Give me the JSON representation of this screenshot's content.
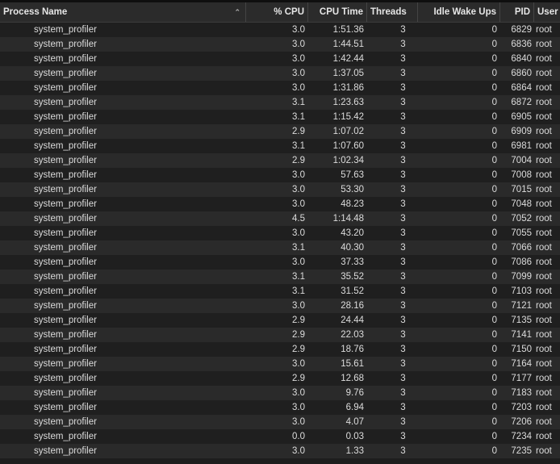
{
  "columns": [
    {
      "label": "Process Name",
      "sorted": "ascending"
    },
    {
      "label": "% CPU"
    },
    {
      "label": "CPU Time"
    },
    {
      "label": "Threads"
    },
    {
      "label": "Idle Wake Ups"
    },
    {
      "label": "PID"
    },
    {
      "label": "User"
    }
  ],
  "sort_icon": "chevron-up-icon",
  "rows": [
    [
      "system_profiler",
      "3.0",
      "1:51.36",
      "3",
      "0",
      "6829",
      "root"
    ],
    [
      "system_profiler",
      "3.0",
      "1:44.51",
      "3",
      "0",
      "6836",
      "root"
    ],
    [
      "system_profiler",
      "3.0",
      "1:42.44",
      "3",
      "0",
      "6840",
      "root"
    ],
    [
      "system_profiler",
      "3.0",
      "1:37.05",
      "3",
      "0",
      "6860",
      "root"
    ],
    [
      "system_profiler",
      "3.0",
      "1:31.86",
      "3",
      "0",
      "6864",
      "root"
    ],
    [
      "system_profiler",
      "3.1",
      "1:23.63",
      "3",
      "0",
      "6872",
      "root"
    ],
    [
      "system_profiler",
      "3.1",
      "1:15.42",
      "3",
      "0",
      "6905",
      "root"
    ],
    [
      "system_profiler",
      "2.9",
      "1:07.02",
      "3",
      "0",
      "6909",
      "root"
    ],
    [
      "system_profiler",
      "3.1",
      "1:07.60",
      "3",
      "0",
      "6981",
      "root"
    ],
    [
      "system_profiler",
      "2.9",
      "1:02.34",
      "3",
      "0",
      "7004",
      "root"
    ],
    [
      "system_profiler",
      "3.0",
      "57.63",
      "3",
      "0",
      "7008",
      "root"
    ],
    [
      "system_profiler",
      "3.0",
      "53.30",
      "3",
      "0",
      "7015",
      "root"
    ],
    [
      "system_profiler",
      "3.0",
      "48.23",
      "3",
      "0",
      "7048",
      "root"
    ],
    [
      "system_profiler",
      "4.5",
      "1:14.48",
      "3",
      "0",
      "7052",
      "root"
    ],
    [
      "system_profiler",
      "3.0",
      "43.20",
      "3",
      "0",
      "7055",
      "root"
    ],
    [
      "system_profiler",
      "3.1",
      "40.30",
      "3",
      "0",
      "7066",
      "root"
    ],
    [
      "system_profiler",
      "3.0",
      "37.33",
      "3",
      "0",
      "7086",
      "root"
    ],
    [
      "system_profiler",
      "3.1",
      "35.52",
      "3",
      "0",
      "7099",
      "root"
    ],
    [
      "system_profiler",
      "3.1",
      "31.52",
      "3",
      "0",
      "7103",
      "root"
    ],
    [
      "system_profiler",
      "3.0",
      "28.16",
      "3",
      "0",
      "7121",
      "root"
    ],
    [
      "system_profiler",
      "2.9",
      "24.44",
      "3",
      "0",
      "7135",
      "root"
    ],
    [
      "system_profiler",
      "2.9",
      "22.03",
      "3",
      "0",
      "7141",
      "root"
    ],
    [
      "system_profiler",
      "2.9",
      "18.76",
      "3",
      "0",
      "7150",
      "root"
    ],
    [
      "system_profiler",
      "3.0",
      "15.61",
      "3",
      "0",
      "7164",
      "root"
    ],
    [
      "system_profiler",
      "2.9",
      "12.68",
      "3",
      "0",
      "7177",
      "root"
    ],
    [
      "system_profiler",
      "3.0",
      "9.76",
      "3",
      "0",
      "7183",
      "root"
    ],
    [
      "system_profiler",
      "3.0",
      "6.94",
      "3",
      "0",
      "7203",
      "root"
    ],
    [
      "system_profiler",
      "3.0",
      "4.07",
      "3",
      "0",
      "7206",
      "root"
    ],
    [
      "system_profiler",
      "0.0",
      "0.03",
      "3",
      "0",
      "7234",
      "root"
    ],
    [
      "system_profiler",
      "3.0",
      "1.33",
      "3",
      "0",
      "7235",
      "root"
    ]
  ]
}
